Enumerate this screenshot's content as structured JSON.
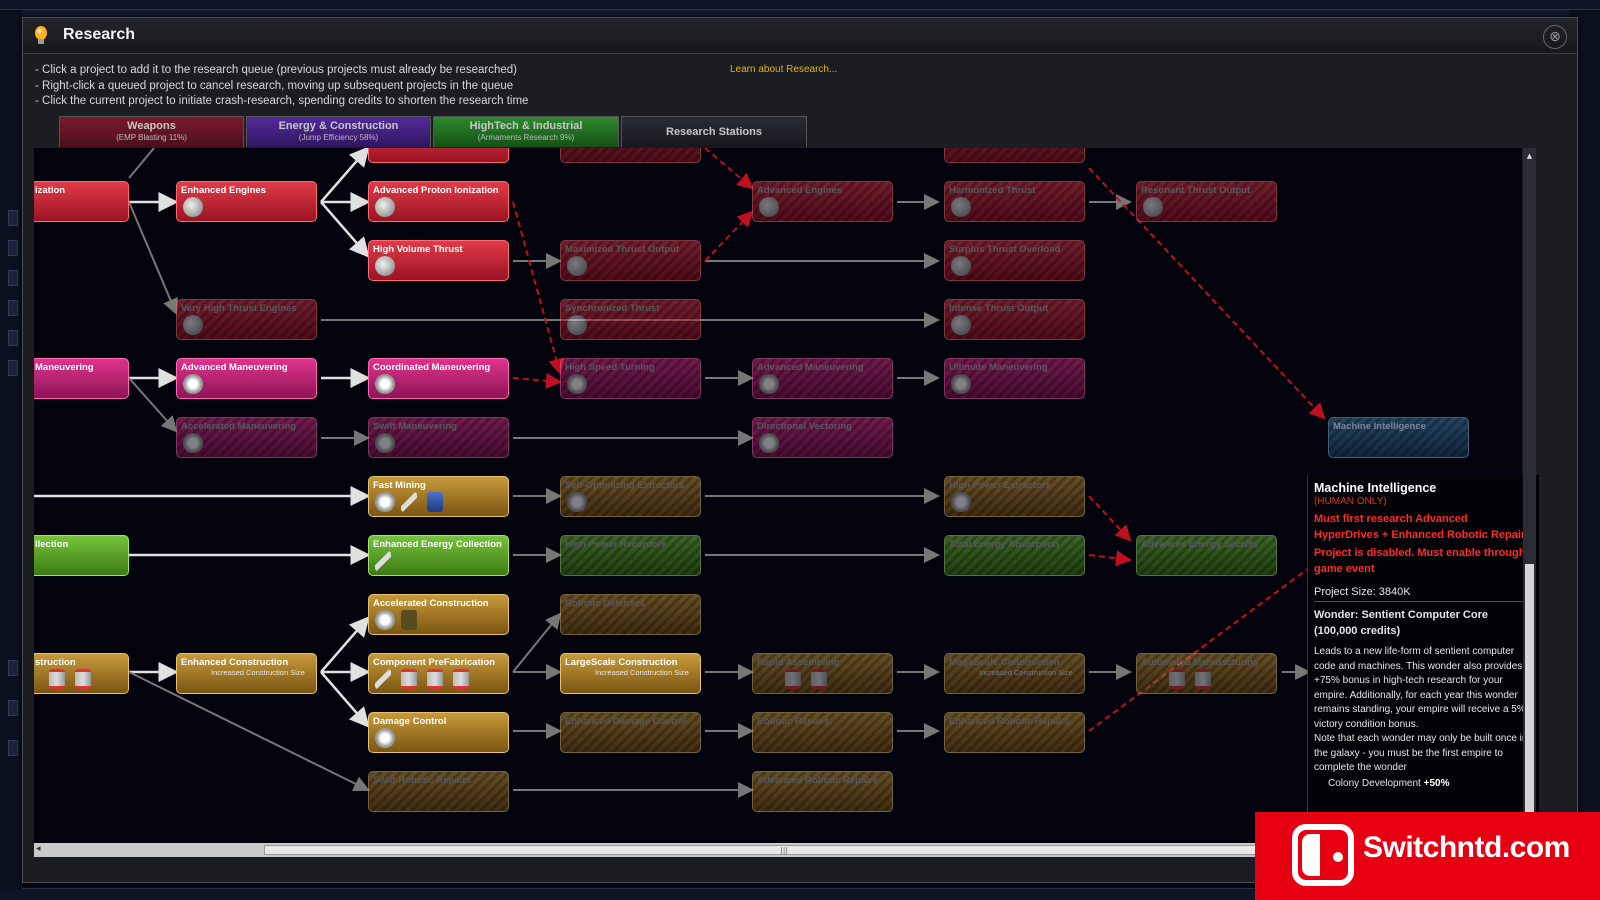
{
  "window": {
    "title": "Research",
    "close_label": "⊗"
  },
  "instructions": [
    "- Click a project to add it to the research queue (previous projects must already be researched)",
    "- Right-click a queued project to cancel research, moving up subsequent projects in the queue",
    "- Click the current project to initiate crash-research, spending credits to shorten the research time"
  ],
  "learn_link": "Learn about Research...",
  "tabs": [
    {
      "label": "Weapons",
      "sub": "(EMP Blasting 11%)"
    },
    {
      "label": "Energy & Construction",
      "sub": "(Jump Efficiency 58%)"
    },
    {
      "label": "HighTech & Industrial",
      "sub": "(Armaments Research 9%)"
    },
    {
      "label": "Research Stations",
      "sub": ""
    }
  ],
  "nodes": {
    "ionization": "ization",
    "enhanced_engines": "Enhanced Engines",
    "adv_proton": "Advanced Proton Ionization",
    "high_volume": "High Volume Thrust",
    "max_thrust": "Maximized Thrust Output",
    "adv_engines": "Advanced Engines",
    "harmonized": "Harmonized Thrust",
    "resonant": "Resonant Thrust Output",
    "surplus": "Surplus Thrust Overload",
    "very_high": "Very High Thrust Engines",
    "synchronized": "Synchronized Thrust",
    "intense": "Intense Thrust Output",
    "maneuvering": "Maneuvering",
    "adv_maneuvering": "Advanced Maneuvering",
    "coord_maneuvering": "Coordinated Maneuvering",
    "high_speed": "High Speed Turning",
    "adv_maneuvering2": "Advanced Maneuvering",
    "ultimate": "Ultimate Maneuvering",
    "accel_maneuvering": "Accelerated Maneuvering",
    "swift_maneuvering": "Swift Maneuvering",
    "directional": "Directional Vectoring",
    "machine_intel": "Machine Intelligence",
    "fast_mining": "Fast Mining",
    "self_opt": "Self-Optimizing Extractors",
    "high_power_ext": "High Power Extractors",
    "collection": "llection",
    "enh_energy": "Enhanced Energy Collection",
    "high_power_rec": "High Power Receptors",
    "total_energy": "Total Energy Absorption",
    "adv_energy": "Advanced Energy Secrets",
    "accel_construction": "Accelerated Construction",
    "robotic_defenses": "Robotic Defenses",
    "construction": "struction",
    "enh_construction": "Enhanced Construction",
    "enh_construction_sub": "Increased Construction Size",
    "component": "Component PreFabrication",
    "largescale": "LargeScale Construction",
    "largescale_sub": "Increased Construction Size",
    "rapid": "Rapid Assembling",
    "megascale": "MegaScale Construction",
    "megascale_sub": "Increased Construction Size",
    "automated": "Automated Manufacturing",
    "damage_control": "Damage Control",
    "enh_damage": "Enhanced Damage Control",
    "robotic_repairs": "Robotic Repairs",
    "enh_robotic": "Enhanced Robotic Repairs",
    "swift_robotic": "Swift Robotic Repairs",
    "adv_robotic": "Advanced Robotic Repairs"
  },
  "tooltip": {
    "name": "Machine Intelligence",
    "tag": "(HUMAN ONLY)",
    "req1": "Must first research Advanced HyperDrives + Enhanced Robotic Repairs",
    "req2": "Project is disabled. Must enable through game event",
    "size": "Project Size: 3840K",
    "wonder": "Wonder: Sentient Computer Core (100,000 credits)",
    "desc": "Leads to a new life-form of sentient computer code and machines. This wonder also provides a +75% bonus in high-tech research for your empire. Additionally, for each year this wonder remains standing, your empire will receive a 5% victory condition bonus.",
    "note": "Note that each wonder may only be built once in the galaxy - you must be the first empire to complete the wonder",
    "bonus_label": "Colony Development",
    "bonus_value": "+50%"
  },
  "banner": {
    "text": "Switchntd.com"
  },
  "colors": {
    "red_node": "#e23a48",
    "magenta_node": "#e0338c",
    "gold_node": "#c79a3a",
    "green_node": "#76c43a",
    "requirement_text": "#ff2a2a",
    "link_gold": "#e6b400",
    "banner": "#e60012"
  }
}
